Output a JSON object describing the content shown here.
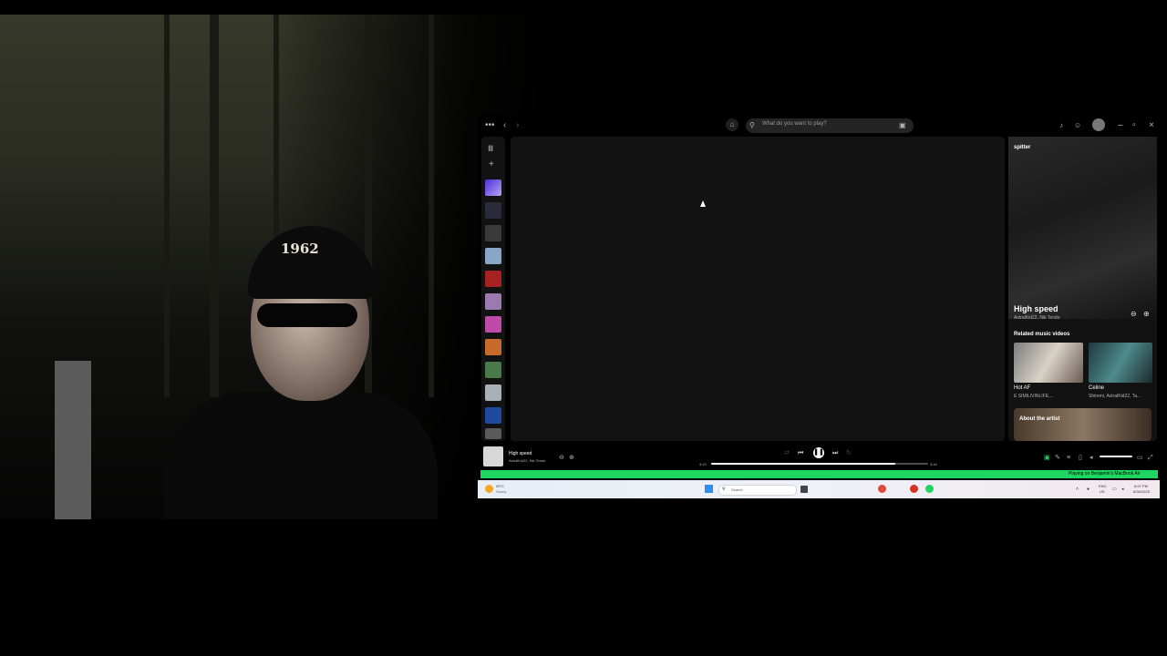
{
  "search": {
    "placeholder": "What do you want to play?"
  },
  "now_playing_panel": {
    "label": "spitter",
    "title": "High speed",
    "artists": "AstralKid22, Nik Tendo",
    "related_heading": "Related music videos",
    "related": [
      {
        "title": "Hot AF",
        "subtitle": "E SIMILIVINLIFE,..."
      },
      {
        "title": "Celine",
        "subtitle": "Shiremi, AstralKid22, Ta..."
      }
    ],
    "about_label": "About the artist"
  },
  "player": {
    "track_title": "High speed",
    "track_artists": "AstralKid22, Nik Tendo",
    "elapsed": "3:10",
    "duration": "3:44",
    "progress": 0.85,
    "volume": 1.0
  },
  "device_bar": {
    "text": "Playing on Benjamin's MacBook Air"
  },
  "taskbar": {
    "weather_temp": "29°C",
    "weather_desc": "Sunny",
    "search_label": "Search",
    "lang1": "ENG",
    "lang2": "US",
    "time": "8:57 PM",
    "date": "8/26/2025"
  },
  "webcam": {
    "cap_text": "1962"
  },
  "colors": {
    "spotify_green": "#1ed760",
    "panel": "#121212",
    "liked_songs": "#7b4dff"
  }
}
